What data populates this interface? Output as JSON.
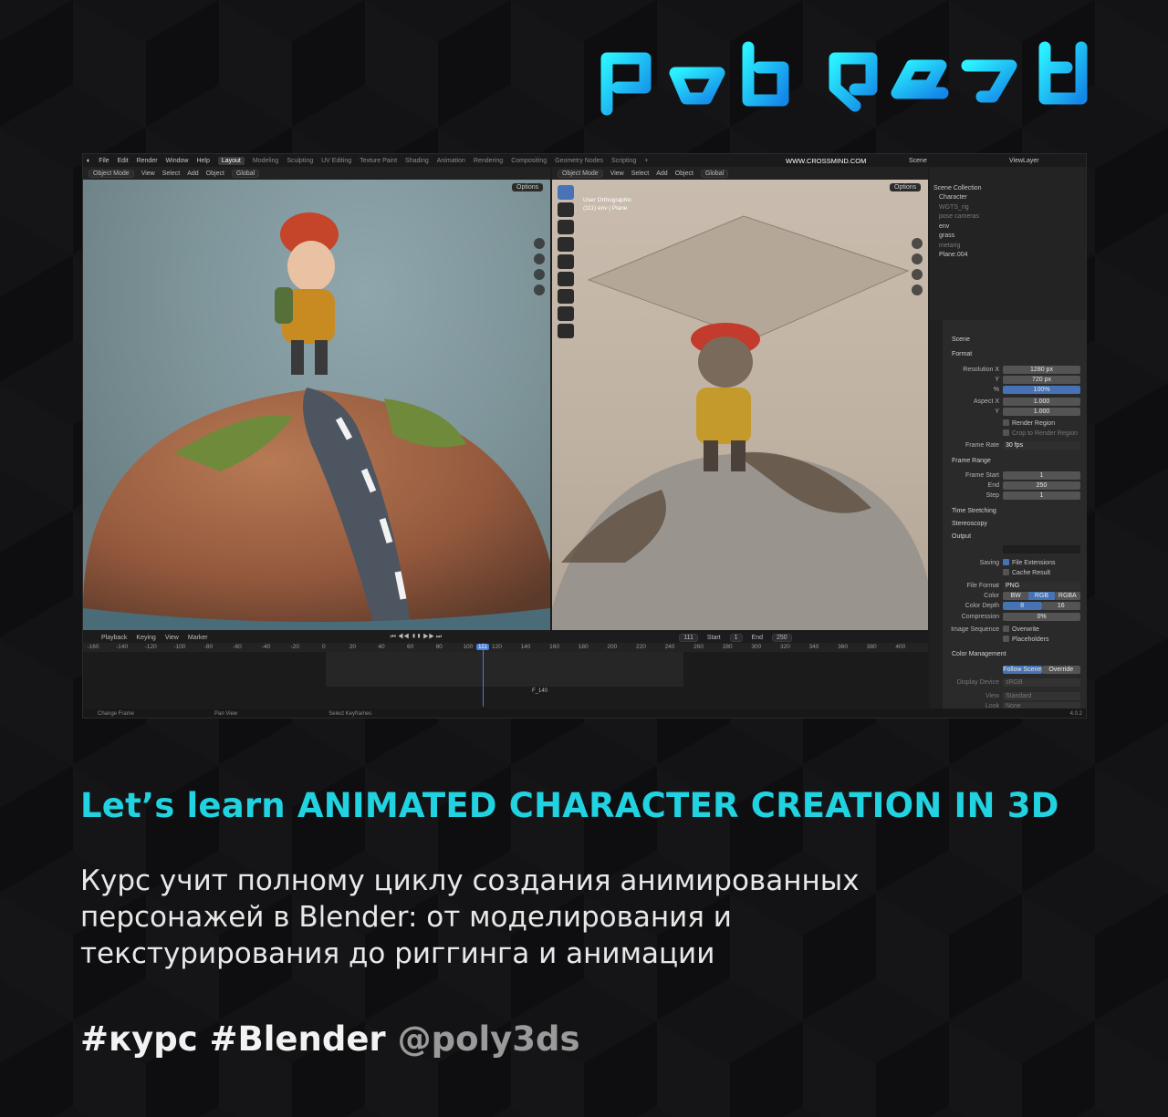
{
  "brand": {
    "logo_text": "poly3ds"
  },
  "colors": {
    "accent": "#21d3e0",
    "background": "#0e0e10",
    "blender_blue": "#4772b3"
  },
  "app": {
    "menu": [
      "File",
      "Edit",
      "Render",
      "Window",
      "Help"
    ],
    "workspaces": [
      "Layout",
      "Modeling",
      "Sculpting",
      "UV Editing",
      "Texture Paint",
      "Shading",
      "Animation",
      "Rendering",
      "Compositing",
      "Geometry Nodes",
      "Scripting"
    ],
    "watermark": "WWW.CROSSMIND.COM",
    "scene_label": "Scene",
    "view_layer": "ViewLayer",
    "left_viewport": {
      "mode": "Object Mode",
      "menus": [
        "View",
        "Select",
        "Add",
        "Object"
      ],
      "transform": "Global",
      "options": "Options"
    },
    "right_viewport": {
      "mode": "Object Mode",
      "menus": [
        "View",
        "Select",
        "Add",
        "Object"
      ],
      "transform": "Global",
      "options": "Options",
      "label_line1": "User Orthographic",
      "label_line2": "(111) env | Plane"
    },
    "outliner": {
      "root": "Scene Collection",
      "items": [
        {
          "name": "Character",
          "dim": false
        },
        {
          "name": "WGTS_rig",
          "dim": true
        },
        {
          "name": "pose cameras",
          "dim": true
        },
        {
          "name": "env",
          "dim": false
        },
        {
          "name": "grass",
          "dim": false
        },
        {
          "name": "metarig",
          "dim": true
        },
        {
          "name": "Plane.004",
          "dim": false
        }
      ]
    },
    "properties": {
      "scene": "Scene",
      "format_label": "Format",
      "resolution_x_label": "Resolution X",
      "resolution_x": "1280 px",
      "resolution_y_label": "Y",
      "resolution_y": "720 px",
      "resolution_pct_label": "%",
      "resolution_pct": "100%",
      "aspect_x_label": "Aspect X",
      "aspect_x": "1.000",
      "aspect_y_label": "Y",
      "aspect_y": "1.000",
      "render_region": "Render Region",
      "crop_region": "Crop to Render Region",
      "frame_rate_label": "Frame Rate",
      "frame_rate": "30 fps",
      "frame_range_label": "Frame Range",
      "frame_start_label": "Frame Start",
      "frame_start": "1",
      "end_label": "End",
      "end": "250",
      "step_label": "Step",
      "step": "1",
      "time_stretching": "Time Stretching",
      "stereoscopy": "Stereoscopy",
      "output_label": "Output",
      "saving_label": "Saving",
      "file_extensions": "File Extensions",
      "cache_result": "Cache Result",
      "file_format_label": "File Format",
      "file_format": "PNG",
      "color_label": "Color",
      "color_bw": "BW",
      "color_rgb": "RGB",
      "color_rgba": "RGBA",
      "color_depth_label": "Color Depth",
      "depth_8": "8",
      "depth_16": "16",
      "compression_label": "Compression",
      "compression": "0%",
      "image_sequence_label": "Image Sequence",
      "overwrite": "Overwrite",
      "placeholders": "Placeholders",
      "color_management": "Color Management",
      "follow_scene": "Follow Scene",
      "override": "Override",
      "display_device_label": "Display Device",
      "display_device": "sRGB",
      "view_label": "View",
      "view_value": "Standard",
      "look_label": "Look",
      "look_value": "None",
      "version": "4.0.2"
    },
    "timeline": {
      "menus": [
        "Playback",
        "Keying",
        "View",
        "Marker"
      ],
      "current_frame": "111",
      "start_label": "Start",
      "start": "1",
      "end_label": "End",
      "end": "250",
      "ticks": [
        "-160",
        "-140",
        "-120",
        "-100",
        "-80",
        "-60",
        "-40",
        "-20",
        "0",
        "20",
        "40",
        "60",
        "80",
        "100",
        "120",
        "140",
        "160",
        "180",
        "200",
        "220",
        "240",
        "260",
        "280",
        "300",
        "320",
        "340",
        "360",
        "380",
        "400"
      ],
      "marker": "F_140"
    },
    "status_bar": [
      "Change Frame",
      "Pan View",
      "Select Keyframes"
    ]
  },
  "headline": "Let’s learn ANIMATED CHARACTER CREATION IN 3D",
  "description": "Курс учит полному циклу создания анимированных персонажей в Blender: от моделирования и текстурирования до риггинга и анимации",
  "tags": {
    "hashtags": "#курс #Blender",
    "handle": "@poly3ds"
  }
}
